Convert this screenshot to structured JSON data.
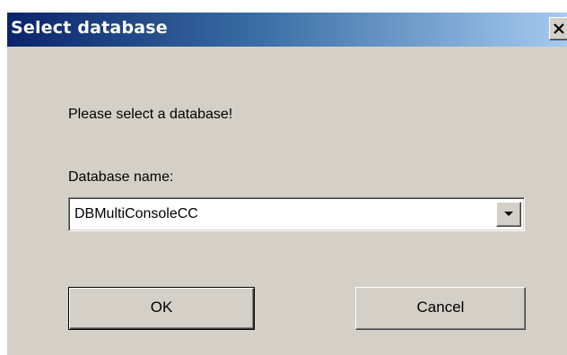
{
  "dialog": {
    "title": "Select database",
    "close_icon": "close-icon",
    "prompt": "Please select a database!",
    "database_label": "Database name:",
    "database_value": "DBMultiConsoleCC",
    "dropdown_icon": "chevron-down-icon",
    "ok_label": "OK",
    "cancel_label": "Cancel"
  },
  "colors": {
    "titlebar_start": "#0a246a",
    "titlebar_end": "#a6caf0",
    "dialog_bg": "#d4d0c8"
  }
}
